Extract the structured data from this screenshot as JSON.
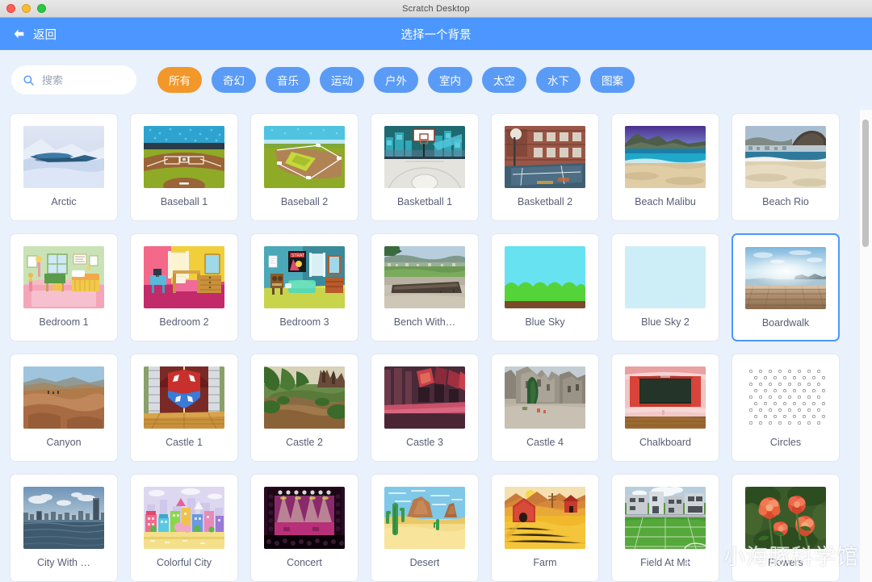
{
  "window": {
    "title": "Scratch Desktop",
    "controls": [
      "close",
      "minimize",
      "zoom"
    ]
  },
  "header": {
    "back_label": "返回",
    "title": "选择一个背景",
    "accent_color": "#4C97FF"
  },
  "search": {
    "placeholder": "搜索",
    "value": "",
    "icon": "search-icon"
  },
  "tags": [
    {
      "label": "所有",
      "active": true
    },
    {
      "label": "奇幻",
      "active": false
    },
    {
      "label": "音乐",
      "active": false
    },
    {
      "label": "运动",
      "active": false
    },
    {
      "label": "户外",
      "active": false
    },
    {
      "label": "室内",
      "active": false
    },
    {
      "label": "太空",
      "active": false
    },
    {
      "label": "水下",
      "active": false
    },
    {
      "label": "图案",
      "active": false
    }
  ],
  "tag_colors": {
    "active": "#F2972A",
    "inactive": "#5A9BF6"
  },
  "selected_item": "Boardwalk",
  "items": [
    {
      "label": "Arctic",
      "art": "arctic",
      "selected": false
    },
    {
      "label": "Baseball 1",
      "art": "baseball1",
      "selected": false
    },
    {
      "label": "Baseball 2",
      "art": "baseball2",
      "selected": false
    },
    {
      "label": "Basketball 1",
      "art": "basketball1",
      "selected": false
    },
    {
      "label": "Basketball 2",
      "art": "basketball2",
      "selected": false
    },
    {
      "label": "Beach Malibu",
      "art": "beachmalibu",
      "selected": false
    },
    {
      "label": "Beach Rio",
      "art": "beachrio",
      "selected": false
    },
    {
      "label": "Bedroom 1",
      "art": "bedroom1",
      "selected": false
    },
    {
      "label": "Bedroom 2",
      "art": "bedroom2",
      "selected": false
    },
    {
      "label": "Bedroom 3",
      "art": "bedroom3",
      "selected": false
    },
    {
      "label": "Bench With…",
      "art": "bench",
      "selected": false
    },
    {
      "label": "Blue Sky",
      "art": "bluesky",
      "selected": false
    },
    {
      "label": "Blue Sky 2",
      "art": "bluesky2",
      "selected": false
    },
    {
      "label": "Boardwalk",
      "art": "boardwalk",
      "selected": true
    },
    {
      "label": "Canyon",
      "art": "canyon",
      "selected": false
    },
    {
      "label": "Castle 1",
      "art": "castle1",
      "selected": false
    },
    {
      "label": "Castle 2",
      "art": "castle2",
      "selected": false
    },
    {
      "label": "Castle 3",
      "art": "castle3",
      "selected": false
    },
    {
      "label": "Castle 4",
      "art": "castle4",
      "selected": false
    },
    {
      "label": "Chalkboard",
      "art": "chalkboard",
      "selected": false
    },
    {
      "label": "Circles",
      "art": "circles",
      "selected": false
    },
    {
      "label": "City With …",
      "art": "citywith",
      "selected": false
    },
    {
      "label": "Colorful City",
      "art": "colorfulcity",
      "selected": false
    },
    {
      "label": "Concert",
      "art": "concert",
      "selected": false
    },
    {
      "label": "Desert",
      "art": "desert",
      "selected": false
    },
    {
      "label": "Farm",
      "art": "farm",
      "selected": false
    },
    {
      "label": "Field At Mit",
      "art": "fieldatmit",
      "selected": false
    },
    {
      "label": "Flowers",
      "art": "flowers",
      "selected": false
    }
  ],
  "watermark": {
    "text": "小海豚科学馆",
    "icon": "wechat-icon"
  },
  "scrollbar": {
    "thumb_top_pct": 2,
    "thumb_height_pct": 27
  }
}
